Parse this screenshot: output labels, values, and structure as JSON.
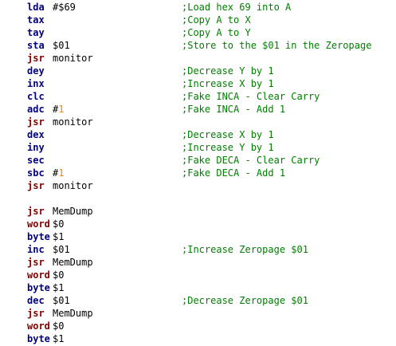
{
  "editor": {
    "lines": [
      {
        "type": "inst",
        "mnemonic": "lda",
        "operand": "#$69",
        "comment": ";Load hex 69 into A"
      },
      {
        "type": "inst",
        "mnemonic": "tax",
        "operand": "",
        "comment": ";Copy A to X"
      },
      {
        "type": "inst",
        "mnemonic": "tay",
        "operand": "",
        "comment": ";Copy A to Y"
      },
      {
        "type": "inst",
        "mnemonic": "sta",
        "operand": "$01",
        "comment": ";Store to the $01 in the Zeropage"
      },
      {
        "type": "call",
        "mnemonic": "jsr",
        "operand": "monitor",
        "comment": ""
      },
      {
        "type": "inst",
        "mnemonic": "dey",
        "operand": "",
        "comment": ";Decrease Y by 1"
      },
      {
        "type": "inst",
        "mnemonic": "inx",
        "operand": "",
        "comment": ";Increase X by 1"
      },
      {
        "type": "inst",
        "mnemonic": "clc",
        "operand": "",
        "comment": ";Fake INCA - Clear Carry"
      },
      {
        "type": "inst",
        "mnemonic": "adc",
        "operand": "#1",
        "comment": ";Fake INCA - Add 1"
      },
      {
        "type": "call",
        "mnemonic": "jsr",
        "operand": "monitor",
        "comment": ""
      },
      {
        "type": "inst",
        "mnemonic": "dex",
        "operand": "",
        "comment": ";Decrease X by 1"
      },
      {
        "type": "inst",
        "mnemonic": "iny",
        "operand": "",
        "comment": ";Increase Y by 1"
      },
      {
        "type": "inst",
        "mnemonic": "sec",
        "operand": "",
        "comment": ";Fake DECA - Clear Carry"
      },
      {
        "type": "inst",
        "mnemonic": "sbc",
        "operand": "#1",
        "comment": ";Fake DECA - Add 1"
      },
      {
        "type": "call",
        "mnemonic": "jsr",
        "operand": "monitor",
        "comment": ""
      },
      {
        "type": "blank",
        "mnemonic": "",
        "operand": "",
        "comment": ""
      },
      {
        "type": "call",
        "mnemonic": "jsr",
        "operand": "MemDump",
        "comment": ""
      },
      {
        "type": "call",
        "mnemonic": "word",
        "operand": "$0",
        "comment": ""
      },
      {
        "type": "inst",
        "mnemonic": "byte",
        "operand": "$1",
        "comment": ""
      },
      {
        "type": "inst",
        "mnemonic": "inc",
        "operand": "$01",
        "comment": ";Increase Zeropage $01"
      },
      {
        "type": "call",
        "mnemonic": "jsr",
        "operand": "MemDump",
        "comment": ""
      },
      {
        "type": "call",
        "mnemonic": "word",
        "operand": "$0",
        "comment": ""
      },
      {
        "type": "inst",
        "mnemonic": "byte",
        "operand": "$1",
        "comment": ""
      },
      {
        "type": "inst",
        "mnemonic": "dec",
        "operand": "$01",
        "comment": ";Decrease Zeropage $01"
      },
      {
        "type": "call",
        "mnemonic": "jsr",
        "operand": "MemDump",
        "comment": ""
      },
      {
        "type": "call",
        "mnemonic": "word",
        "operand": "$0",
        "comment": ""
      },
      {
        "type": "inst",
        "mnemonic": "byte",
        "operand": "$1",
        "comment": ""
      }
    ],
    "colors": {
      "instruction": "#000080",
      "directive_or_call": "#800000",
      "comment": "#008000",
      "number": "#ff8000",
      "background": "#ffffff"
    }
  }
}
